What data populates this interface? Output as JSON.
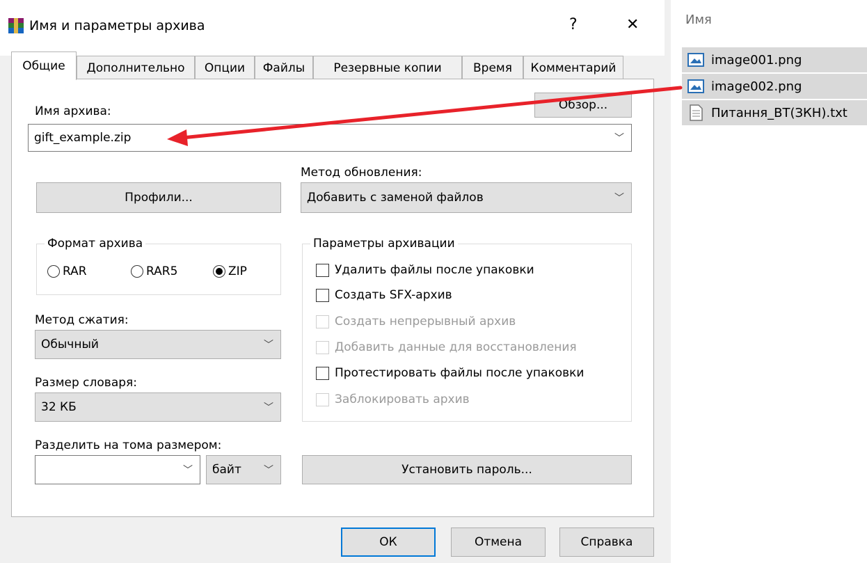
{
  "dialog": {
    "title": "Имя и параметры архива",
    "help_glyph": "?",
    "close_glyph": "✕"
  },
  "tabs": [
    "Общие",
    "Дополнительно",
    "Опции",
    "Файлы",
    "Резервные копии",
    "Время",
    "Комментарий"
  ],
  "archive_name": {
    "label": "Имя архива:",
    "value": "gift_example.zip",
    "browse": "Обзор..."
  },
  "update_method": {
    "label": "Метод обновления:",
    "value": "Добавить с заменой файлов"
  },
  "profiles_button": "Профили...",
  "format": {
    "legend": "Формат архива",
    "options": [
      "RAR",
      "RAR5",
      "ZIP"
    ],
    "selected": "ZIP"
  },
  "archive_params": {
    "legend": "Параметры архивации",
    "items": [
      {
        "label": "Удалить файлы после упаковки",
        "enabled": true,
        "checked": false
      },
      {
        "label": "Создать SFX-архив",
        "enabled": true,
        "checked": false
      },
      {
        "label": "Создать непрерывный архив",
        "enabled": false,
        "checked": false
      },
      {
        "label": "Добавить данные для восстановления",
        "enabled": false,
        "checked": false
      },
      {
        "label": "Протестировать файлы после упаковки",
        "enabled": true,
        "checked": false
      },
      {
        "label": "Заблокировать архив",
        "enabled": false,
        "checked": false
      }
    ]
  },
  "compression": {
    "label": "Метод сжатия:",
    "value": "Обычный"
  },
  "dictionary": {
    "label": "Размер словаря:",
    "value": "32 КБ"
  },
  "split": {
    "label": "Разделить на тома размером:",
    "value": "",
    "unit": "байт"
  },
  "set_password": "Установить пароль...",
  "footer": {
    "ok": "ОК",
    "cancel": "Отмена",
    "help": "Справка"
  },
  "explorer": {
    "header": "Имя",
    "files": [
      {
        "name": "image001.png",
        "icon": "image-file-icon",
        "selected": true
      },
      {
        "name": "image002.png",
        "icon": "image-file-icon",
        "selected": true
      },
      {
        "name": "Питання_ВТ(ЗКН).txt",
        "icon": "text-file-icon",
        "selected": true
      }
    ]
  },
  "colors": {
    "accent": "#0078d7",
    "annotation_arrow": "#e8222a",
    "selection": "#d9d9d9"
  }
}
